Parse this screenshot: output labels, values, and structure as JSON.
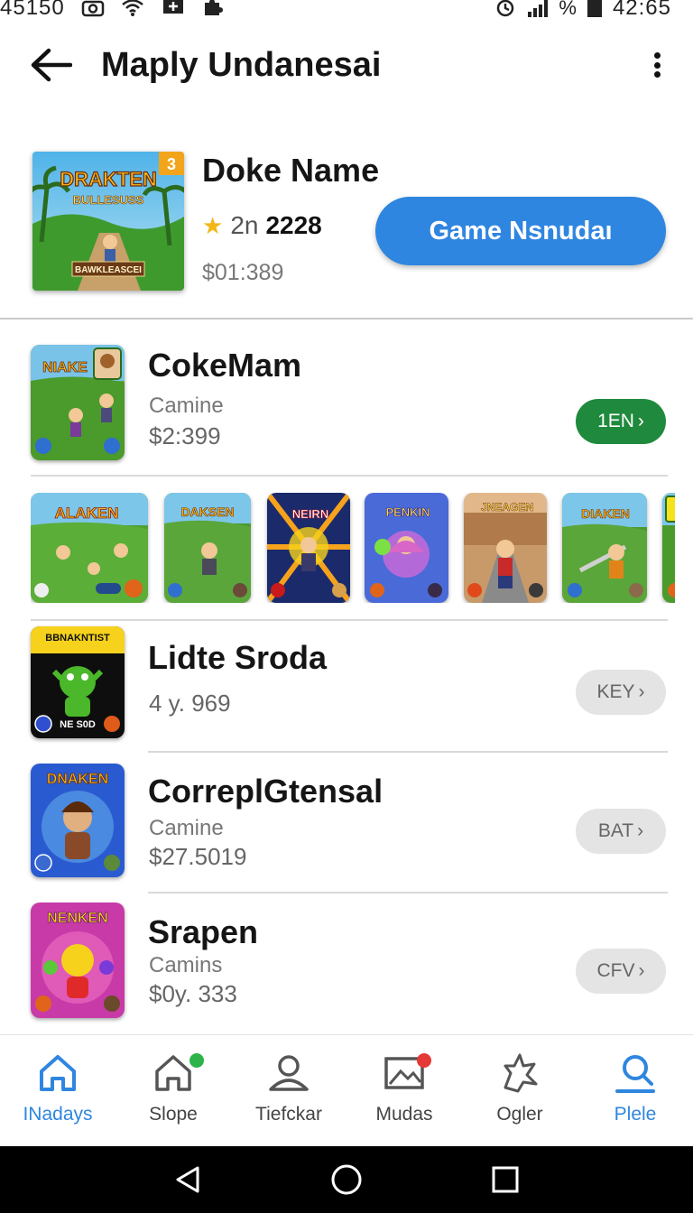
{
  "status_bar": {
    "time_left": "45150",
    "battery_text": "%",
    "time_right": "42:65"
  },
  "app_bar": {
    "title": "Maply Undanesai"
  },
  "hero": {
    "art_label_top": "DRAKTEN",
    "art_label_sub": "BULLESUSS",
    "art_label_bottom": "BAWKLEASCEI",
    "art_badge": "3",
    "name": "Doke Name",
    "rating_prefix": "2n",
    "rating_value": "2228",
    "price": "$01:389",
    "button_label": "Game Nsnudaı"
  },
  "rows": [
    {
      "title": "CokeMam",
      "subtitle": "Camine",
      "price": "$2:399",
      "button": "1EN",
      "thumb_label": "NIAKE"
    },
    {
      "title": "Lidte Sroda",
      "price": "4 y. 969",
      "button": "KEY",
      "thumb_label": "BBNAKNTIST",
      "thumb_footer": "NE S0D"
    },
    {
      "title": "CorreplGtensal",
      "subtitle": "Camine",
      "price": "$27.5019",
      "button": "BAT",
      "thumb_label": "DNAKEN"
    },
    {
      "title": "Srapen",
      "subtitle": "Camins",
      "price": "$0y. 333",
      "button": "CFV",
      "thumb_label": "NENKEN"
    }
  ],
  "screenshots": [
    {
      "label": "ALAKEN"
    },
    {
      "label": "DAKSEN"
    },
    {
      "label": "NEIRN"
    },
    {
      "label": "PENKIN"
    },
    {
      "label": "JNEAGEN"
    },
    {
      "label": "DIAKEN"
    }
  ],
  "bottom_nav": [
    {
      "label": "INadays",
      "icon": "home-icon",
      "active": true
    },
    {
      "label": "Slope",
      "icon": "home-outline-icon",
      "active": false
    },
    {
      "label": "Tiefckar",
      "icon": "person-icon",
      "active": false
    },
    {
      "label": "Mudas",
      "icon": "picture-icon",
      "active": false
    },
    {
      "label": "Ogler",
      "icon": "puzzle-icon",
      "active": false
    },
    {
      "label": "Plele",
      "icon": "profile-icon",
      "active": true
    }
  ],
  "colors": {
    "accent": "#2f86e0",
    "green_button": "#1f8a3d",
    "grey_button": "#e4e4e4",
    "star": "#f2b619",
    "badge_green": "#2db34a",
    "badge_red": "#e53935"
  }
}
